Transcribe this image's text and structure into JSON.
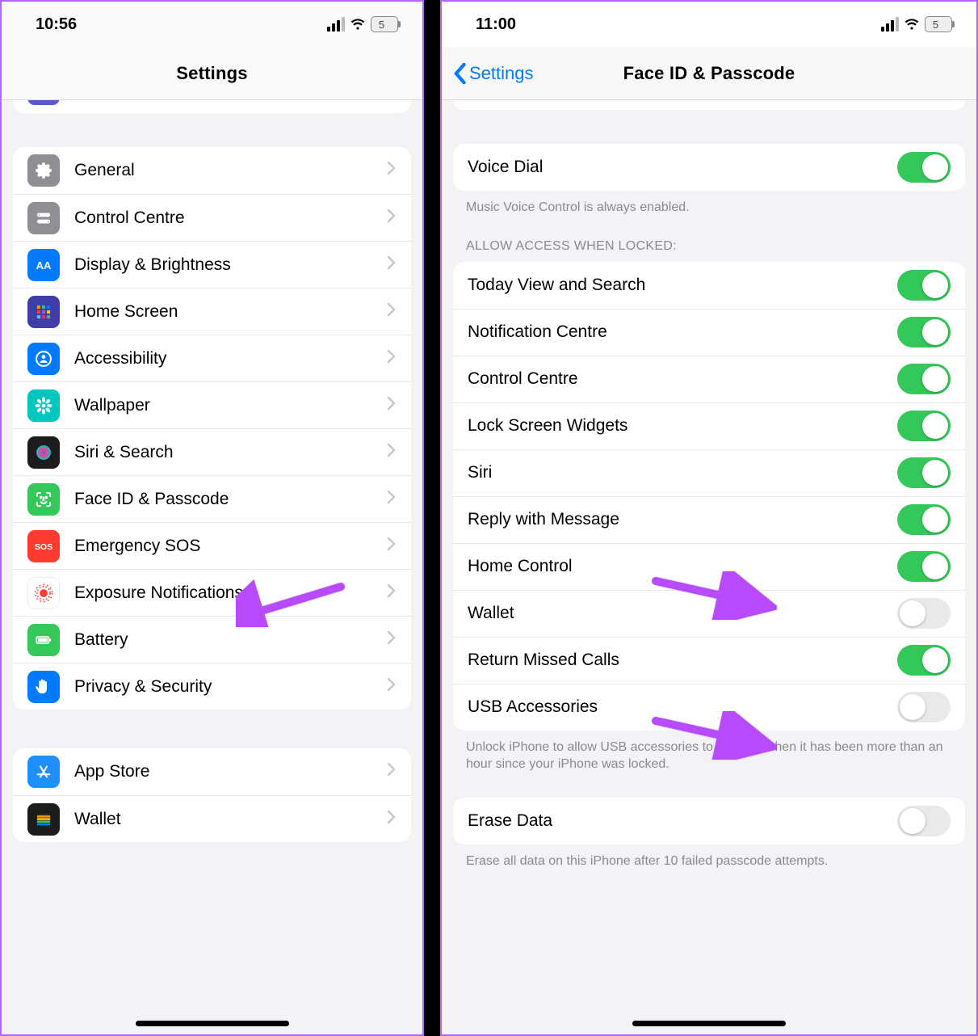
{
  "left": {
    "time": "10:56",
    "battery": "5",
    "title": "Settings",
    "group1": [
      {
        "id": "general",
        "label": "General",
        "color": "#8e8e93",
        "icon": "gear"
      },
      {
        "id": "control-centre",
        "label": "Control Centre",
        "color": "#8e8e93",
        "icon": "toggles"
      },
      {
        "id": "display",
        "label": "Display & Brightness",
        "color": "#007aff",
        "icon": "aa"
      },
      {
        "id": "home-screen",
        "label": "Home Screen",
        "color": "#3f3ea8",
        "icon": "grid"
      },
      {
        "id": "accessibility",
        "label": "Accessibility",
        "color": "#007aff",
        "icon": "person"
      },
      {
        "id": "wallpaper",
        "label": "Wallpaper",
        "color": "#00c7be",
        "icon": "flower"
      },
      {
        "id": "siri",
        "label": "Siri & Search",
        "color": "#1c1c1e",
        "icon": "siri"
      },
      {
        "id": "faceid",
        "label": "Face ID & Passcode",
        "color": "#34c759",
        "icon": "faceid"
      },
      {
        "id": "sos",
        "label": "Emergency SOS",
        "color": "#ff3b30",
        "icon": "sos"
      },
      {
        "id": "exposure",
        "label": "Exposure Notifications",
        "color": "#ffffff",
        "icon": "exposure"
      },
      {
        "id": "battery",
        "label": "Battery",
        "color": "#34c759",
        "icon": "battery"
      },
      {
        "id": "privacy",
        "label": "Privacy & Security",
        "color": "#007aff",
        "icon": "hand"
      }
    ],
    "group2": [
      {
        "id": "appstore",
        "label": "App Store",
        "color": "#1e90ff",
        "icon": "appstore"
      },
      {
        "id": "wallet",
        "label": "Wallet",
        "color": "#1c1c1e",
        "icon": "wallet"
      }
    ]
  },
  "right": {
    "time": "11:00",
    "battery": "5",
    "back_label": "Settings",
    "title": "Face ID & Passcode",
    "voice_dial": {
      "label": "Voice Dial",
      "on": true
    },
    "voice_dial_footer": "Music Voice Control is always enabled.",
    "section_header": "ALLOW ACCESS WHEN LOCKED:",
    "locked": [
      {
        "id": "today",
        "label": "Today View and Search",
        "on": true
      },
      {
        "id": "notif",
        "label": "Notification Centre",
        "on": true
      },
      {
        "id": "cc",
        "label": "Control Centre",
        "on": true
      },
      {
        "id": "widgets",
        "label": "Lock Screen Widgets",
        "on": true
      },
      {
        "id": "siri",
        "label": "Siri",
        "on": true
      },
      {
        "id": "reply",
        "label": "Reply with Message",
        "on": true
      },
      {
        "id": "homecontrol",
        "label": "Home Control",
        "on": true
      },
      {
        "id": "wallet",
        "label": "Wallet",
        "on": false
      },
      {
        "id": "missed",
        "label": "Return Missed Calls",
        "on": true
      },
      {
        "id": "usb",
        "label": "USB Accessories",
        "on": false
      }
    ],
    "usb_footer": "Unlock iPhone to allow USB accessories to connect when it has been more than an hour since your iPhone was locked.",
    "erase": {
      "label": "Erase Data",
      "on": false
    },
    "erase_footer": "Erase all data on this iPhone after 10 failed passcode attempts."
  },
  "annotation_color": "#b84aff"
}
